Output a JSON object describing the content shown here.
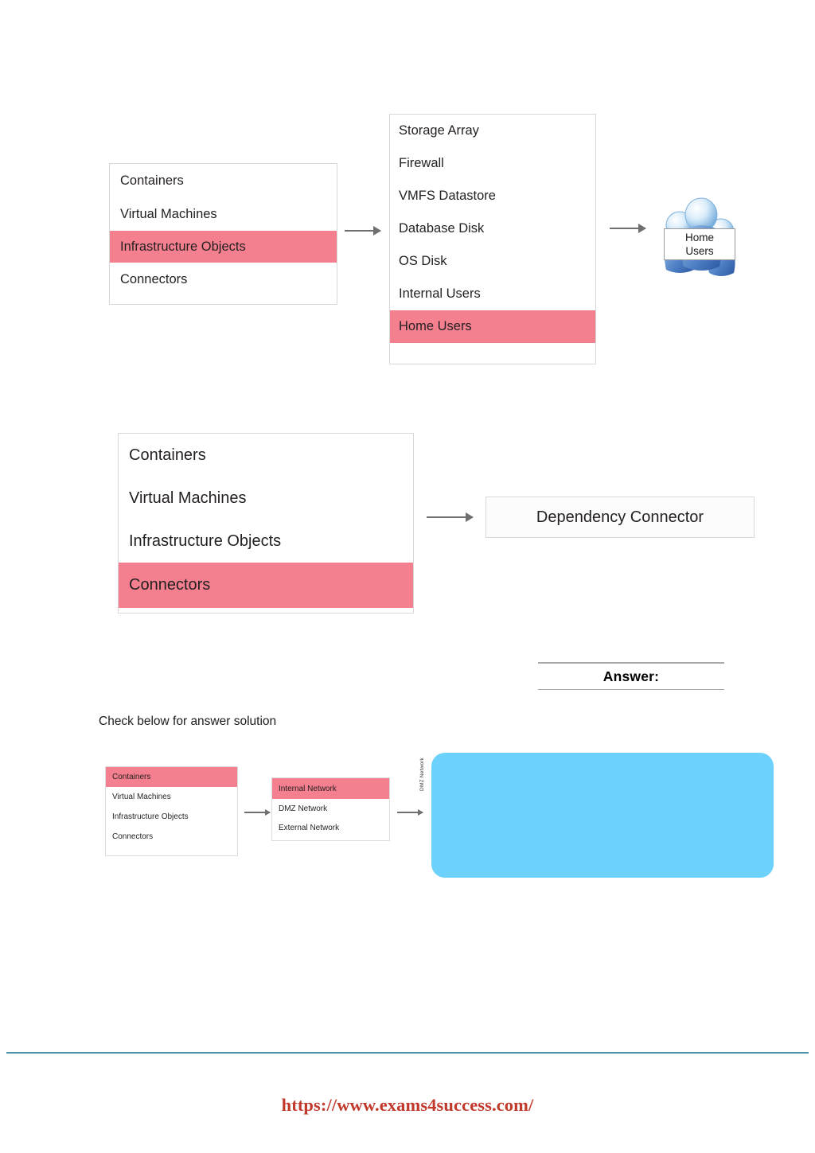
{
  "page": {
    "check_note": "Check below for answer solution",
    "answer_label": "Answer:",
    "footer_url": "https://www.exams4success.com/"
  },
  "question_diagram_1": {
    "source_list": {
      "items": [
        {
          "label": "Containers",
          "highlighted": false
        },
        {
          "label": "Virtual Machines",
          "highlighted": false
        },
        {
          "label": "Infrastructure Objects",
          "highlighted": true
        },
        {
          "label": "Connectors",
          "highlighted": false
        }
      ]
    },
    "middle_list": {
      "items": [
        {
          "label": "Storage Array",
          "highlighted": false
        },
        {
          "label": "Firewall",
          "highlighted": false
        },
        {
          "label": "VMFS Datastore",
          "highlighted": false
        },
        {
          "label": "Database Disk",
          "highlighted": false
        },
        {
          "label": "OS Disk",
          "highlighted": false
        },
        {
          "label": "Internal Users",
          "highlighted": false
        },
        {
          "label": "Home Users",
          "highlighted": true
        }
      ]
    },
    "result_icon": {
      "icon": "people-group-icon",
      "label_line1": "Home",
      "label_line2": "Users"
    }
  },
  "question_diagram_2": {
    "source_list": {
      "items": [
        {
          "label": "Containers",
          "highlighted": false
        },
        {
          "label": "Virtual Machines",
          "highlighted": false
        },
        {
          "label": "Infrastructure Objects",
          "highlighted": false
        },
        {
          "label": "Connectors",
          "highlighted": true
        }
      ]
    },
    "target_box": {
      "label": "Dependency Connector"
    }
  },
  "answer_diagram": {
    "source_list": {
      "items": [
        {
          "label": "Containers",
          "highlighted": true
        },
        {
          "label": "Virtual Machines",
          "highlighted": false
        },
        {
          "label": "Infrastructure Objects",
          "highlighted": false
        },
        {
          "label": "Connectors",
          "highlighted": false
        }
      ]
    },
    "middle_list": {
      "items": [
        {
          "label": "Internal Network",
          "highlighted": true
        },
        {
          "label": "DMZ Network",
          "highlighted": false
        },
        {
          "label": "External Network",
          "highlighted": false
        }
      ]
    },
    "result_panel": {
      "side_label": "DMZ Network",
      "body_text": ""
    }
  },
  "colors": {
    "highlight": "#F4808F",
    "result_panel": "#6DD2FB",
    "footer_rule": "#4A90A4",
    "footer_text": "#C0392B",
    "arrow": "#6F6F6F"
  }
}
